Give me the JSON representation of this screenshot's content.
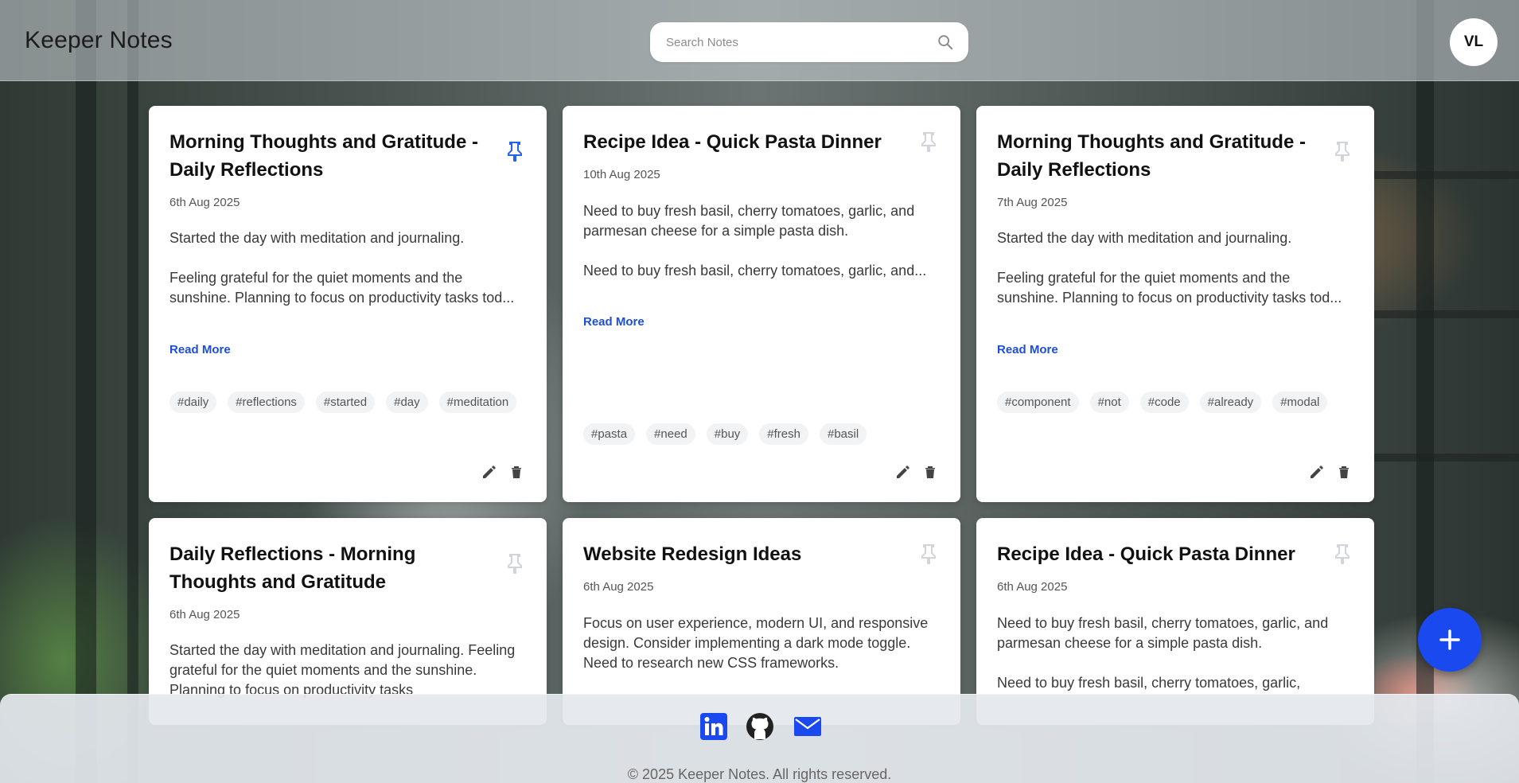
{
  "header": {
    "brand": "Keeper Notes",
    "search_placeholder": "Search Notes",
    "avatar_initials": "VL"
  },
  "notes": [
    {
      "title": "Morning Thoughts and Gratitude - Daily Reflections",
      "date": "6th Aug 2025",
      "body": "Started the day with meditation and journaling.\n\nFeeling grateful for the quiet moments and the sunshine. Planning to focus on productivity tasks tod...",
      "read_more": "Read More",
      "pinned": true,
      "tags": [
        "#daily",
        "#reflections",
        "#started",
        "#day",
        "#meditation"
      ]
    },
    {
      "title": "Recipe Idea - Quick Pasta Dinner",
      "date": "10th Aug 2025",
      "body": "Need to buy fresh basil, cherry tomatoes, garlic, and parmesan cheese for a simple pasta dish.\n\nNeed to buy fresh basil, cherry tomatoes, garlic, and...",
      "read_more": "Read More",
      "pinned": false,
      "tags": [
        "#pasta",
        "#need",
        "#buy",
        "#fresh",
        "#basil"
      ]
    },
    {
      "title": "Morning Thoughts and Gratitude - Daily Reflections",
      "date": "7th Aug 2025",
      "body": "Started the day with meditation and journaling.\n\nFeeling grateful for the quiet moments and the sunshine. Planning to focus on productivity tasks tod...",
      "read_more": "Read More",
      "pinned": false,
      "tags": [
        "#component",
        "#not",
        "#code",
        "#already",
        "#modal"
      ]
    },
    {
      "title": "Daily Reflections - Morning Thoughts and Gratitude",
      "date": "6th Aug 2025",
      "body": "Started the day with meditation and journaling. Feeling grateful for the quiet moments and the sunshine. Planning to focus on productivity tasks",
      "pinned": false
    },
    {
      "title": "Website Redesign Ideas",
      "date": "6th Aug 2025",
      "body": "Focus on user experience, modern UI, and responsive design. Consider implementing a dark mode toggle. Need to research new CSS frameworks.",
      "pinned": false
    },
    {
      "title": "Recipe Idea - Quick Pasta Dinner",
      "date": "6th Aug 2025",
      "body": "Need to buy fresh basil, cherry tomatoes, garlic, and parmesan cheese for a simple pasta dish.\n\nNeed to buy fresh basil, cherry tomatoes, garlic,",
      "pinned": false
    }
  ],
  "icons": {
    "search": "search-icon",
    "pin": "pin-icon",
    "edit": "pencil-icon",
    "delete": "trash-icon",
    "add": "plus-icon",
    "linkedin": "linkedin-icon",
    "github": "github-icon",
    "email": "envelope-icon"
  },
  "colors": {
    "accent": "#1a49f0",
    "link": "#1d4ed8",
    "pin_active": "#2563eb",
    "pin_inactive": "#d1d5db"
  },
  "footer": {
    "copyright": "© 2025 Keeper Notes. All rights reserved."
  }
}
